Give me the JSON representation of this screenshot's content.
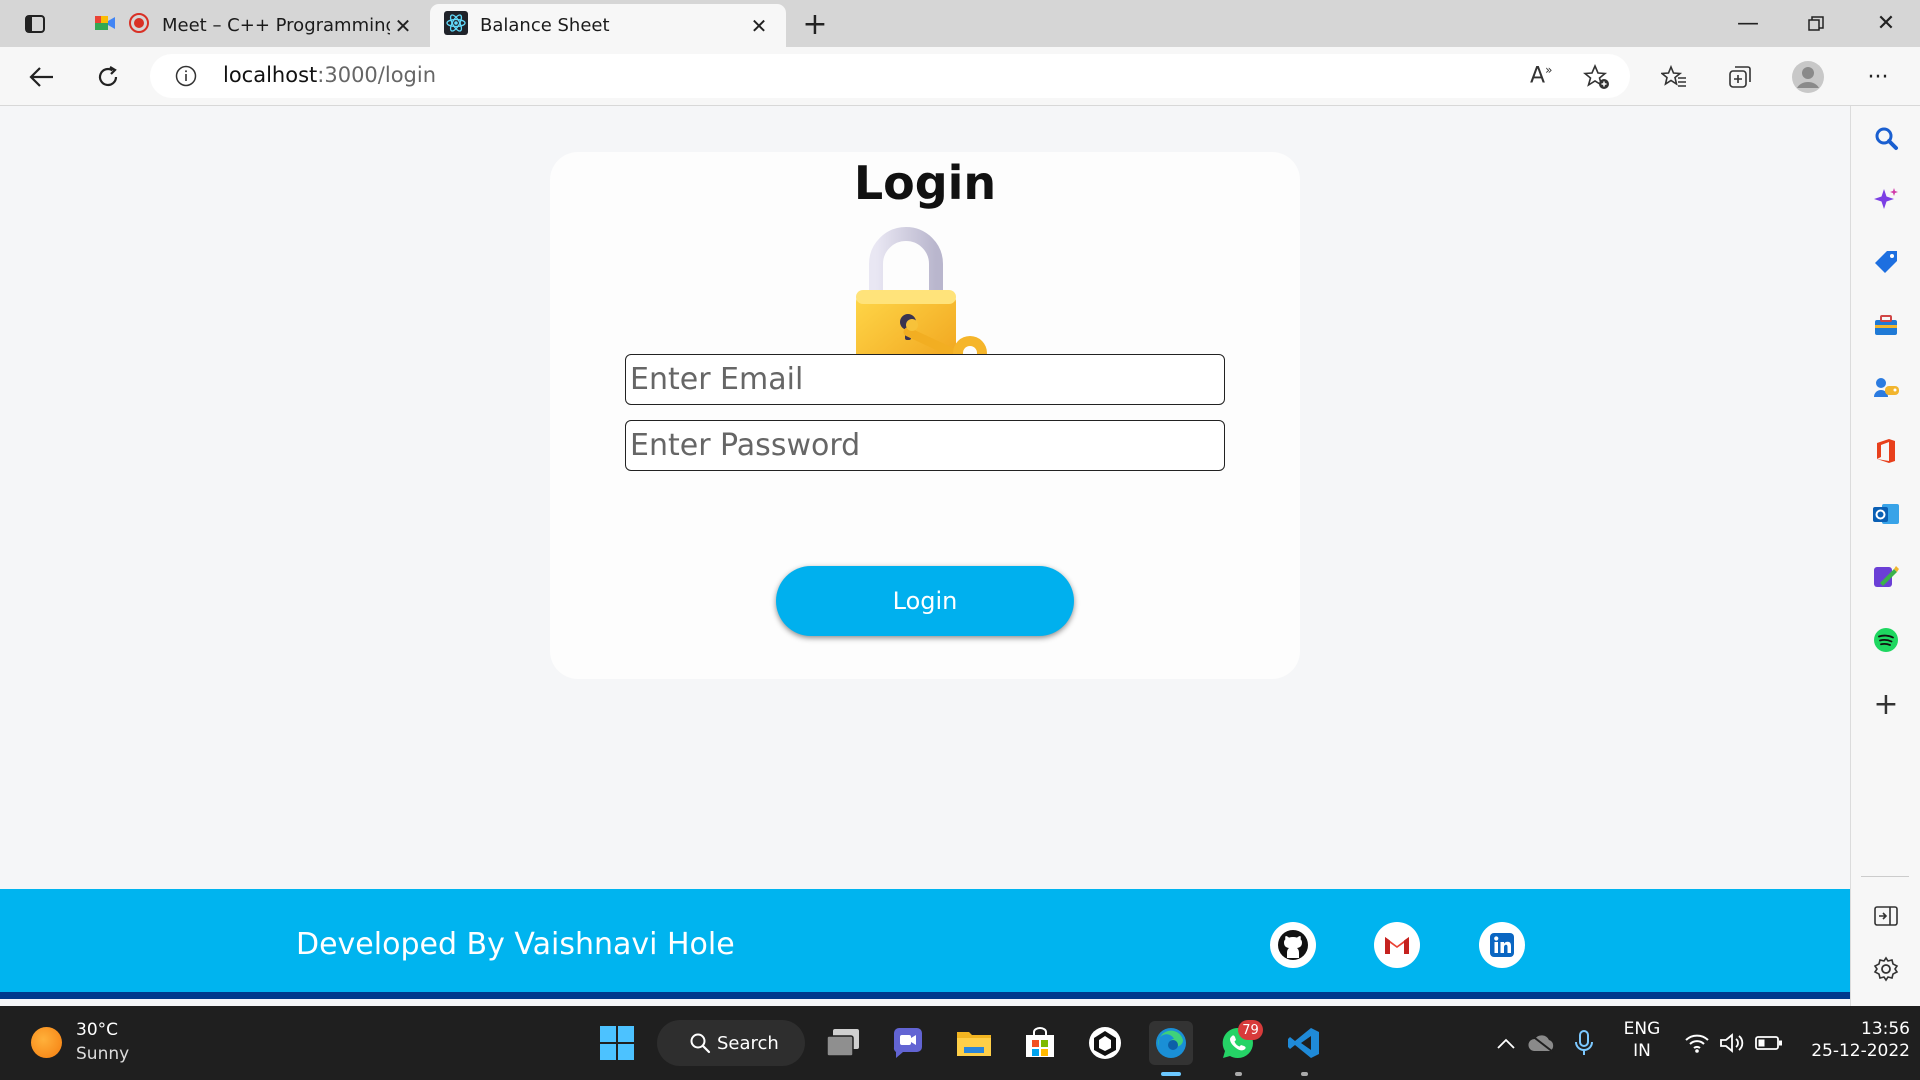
{
  "browser": {
    "tabs": [
      {
        "title": "Meet – C++ Programming I",
        "active": false
      },
      {
        "title": "Balance Sheet",
        "active": true
      }
    ],
    "url_host": "localhost",
    "url_path": ":3000/login"
  },
  "page": {
    "heading": "Login",
    "email_placeholder": "Enter Email",
    "password_placeholder": "Enter Password",
    "login_button": "Login",
    "footer_text": "Developed By Vaishnavi Hole",
    "accent_color": "#00b4ef"
  },
  "taskbar": {
    "weather_temp": "30°C",
    "weather_desc": "Sunny",
    "search_label": "Search",
    "whatsapp_badge": "79",
    "lang_line1": "ENG",
    "lang_line2": "IN",
    "time": "13:56",
    "date": "25-12-2022"
  }
}
